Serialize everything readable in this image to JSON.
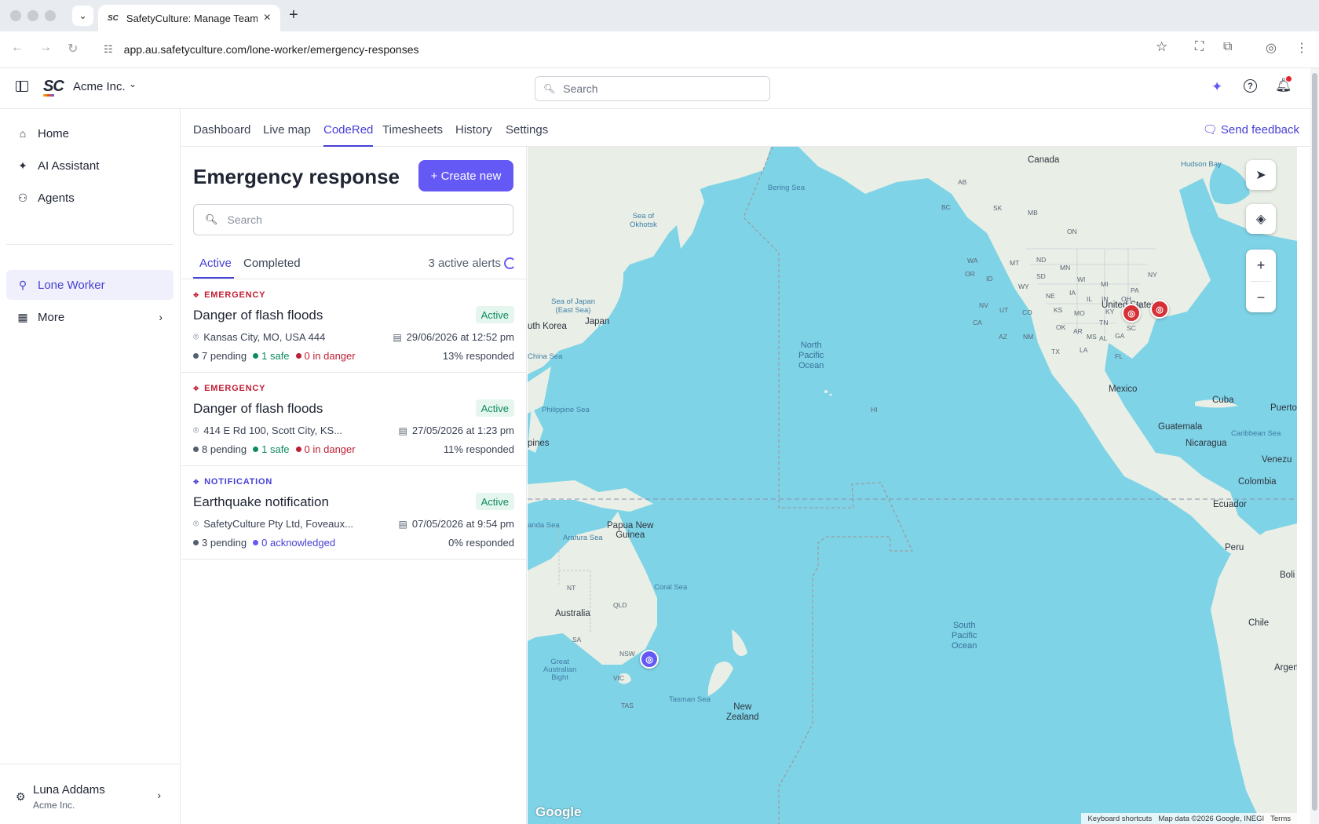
{
  "browser": {
    "tab_title": "SafetyCulture: Manage Teams",
    "tab_favicon": "SC",
    "url": "app.au.safetyculture.com/lone-worker/emergency-responses"
  },
  "header": {
    "org_name": "Acme Inc.",
    "search_placeholder": "Search"
  },
  "sidebar": {
    "items": [
      {
        "label": "Home",
        "icon": "home-icon"
      },
      {
        "label": "AI Assistant",
        "icon": "sparkle-icon"
      },
      {
        "label": "Agents",
        "icon": "agent-icon"
      },
      {
        "label": "Lone Worker",
        "icon": "lone-worker-icon",
        "selected": true
      },
      {
        "label": "More",
        "icon": "grid-icon"
      }
    ],
    "user": {
      "name": "Luna Addams",
      "org": "Acme Inc."
    }
  },
  "subnav": {
    "tabs": [
      "Dashboard",
      "Live map",
      "CodeRed",
      "Timesheets",
      "History",
      "Settings"
    ],
    "selected": "CodeRed",
    "feedback_label": "Send feedback"
  },
  "panel": {
    "title": "Emergency response",
    "create_label": "+ Create new",
    "search_placeholder": "Search",
    "tabs": [
      "Active",
      "Completed"
    ],
    "alert_count": "3 active alerts",
    "cards": [
      {
        "tag": "EMERGENCY",
        "title": "Danger of flash floods",
        "status": "Active",
        "location": "Kansas City, MO, USA 444",
        "date": "29/06/2026 at 12:52 pm",
        "pending": "7 pending",
        "safe": "1 safe",
        "danger": "0 in danger",
        "responded": "13% responded"
      },
      {
        "tag": "EMERGENCY",
        "title": "Danger of flash floods",
        "status": "Active",
        "location": "414 E Rd 100, Scott City, KS...",
        "date": "27/05/2026 at 1:23 pm",
        "pending": "8 pending",
        "safe": "1 safe",
        "danger": "0 in danger",
        "responded": "11% responded"
      },
      {
        "tag": "NOTIFICATION",
        "title": "Earthquake notification",
        "status": "Active",
        "location": "SafetyCulture Pty Ltd, Foveaux...",
        "date": "07/05/2026 at 9:54 pm",
        "pending": "3 pending",
        "acknowledged": "0 acknowledged",
        "responded": "0% responded"
      }
    ]
  },
  "map": {
    "labels": {
      "canada": "Canada",
      "hudson_bay": "Hudson Bay",
      "bering_sea": "Bering Sea",
      "sea_okhotsk_1": "Sea of",
      "sea_okhotsk_2": "Okhotsk",
      "sea_japan_1": "Sea of Japan",
      "sea_japan_2": "(East Sea)",
      "japan": "Japan",
      "south_korea": "uth Korea",
      "china_sea": "China Sea",
      "philippine_sea": "Philippine Sea",
      "philippines": "pines",
      "north_pacific_1": "North",
      "north_pacific_2": "Pacific",
      "north_pacific_3": "Ocean",
      "hi": "HI",
      "united_states": "United States",
      "mexico": "Mexico",
      "cuba": "Cuba",
      "puerto_rico": "Puerto Ric",
      "guatemala": "Guatemala",
      "nicaragua": "Nicaragua",
      "caribbean": "Caribbean Sea",
      "venezuela": "Venezu",
      "colombia": "Colombia",
      "ecuador": "Ecuador",
      "peru": "Peru",
      "bolivia": "Boli",
      "chile": "Chile",
      "argentina": "Argen",
      "south_pacific_1": "South",
      "south_pacific_2": "Pacific",
      "south_pacific_3": "Ocean",
      "banda_sea": "anda Sea",
      "arafura": "Arafura Sea",
      "png_1": "Papua New",
      "png_2": "Guinea",
      "coral_sea": "Coral Sea",
      "australia": "Australia",
      "nt": "NT",
      "qld": "QLD",
      "sa": "SA",
      "nsw": "NSW",
      "vic": "VIC",
      "tas": "TAS",
      "gab_1": "Great",
      "gab_2": "Australian",
      "gab_3": "Bight",
      "tasman": "Tasman Sea",
      "nz_1": "New",
      "nz_2": "Zealand"
    },
    "states": [
      "AB",
      "SK",
      "MB",
      "ON",
      "BC",
      "WA",
      "MT",
      "ND",
      "MN",
      "ID",
      "SD",
      "WI",
      "WY",
      "OR",
      "NE",
      "IA",
      "IL",
      "IN",
      "OH",
      "NV",
      "UT",
      "CO",
      "KS",
      "MO",
      "KY",
      "VA",
      "CA",
      "OK",
      "TN",
      "NC",
      "AZ",
      "NM",
      "AR",
      "SC",
      "TX",
      "MS",
      "AL",
      "GA",
      "LA",
      "FL",
      "NY",
      "MI",
      "PA"
    ],
    "attribution": {
      "shortcuts": "Keyboard shortcuts",
      "data": "Map data ©2026 Google, INEGI",
      "terms": "Terms"
    },
    "google_logo": "Google",
    "markers": [
      {
        "type": "emergency",
        "color": "#d63036"
      },
      {
        "type": "emergency",
        "color": "#d63036"
      },
      {
        "type": "notification",
        "color": "#6559f5"
      }
    ]
  },
  "colors": {
    "accent": "#6559f5",
    "accent_text": "#4740d4",
    "danger": "#c01e34",
    "safe": "#0f8a5f",
    "water": "#7fd3e6",
    "land": "#e9efe6"
  }
}
